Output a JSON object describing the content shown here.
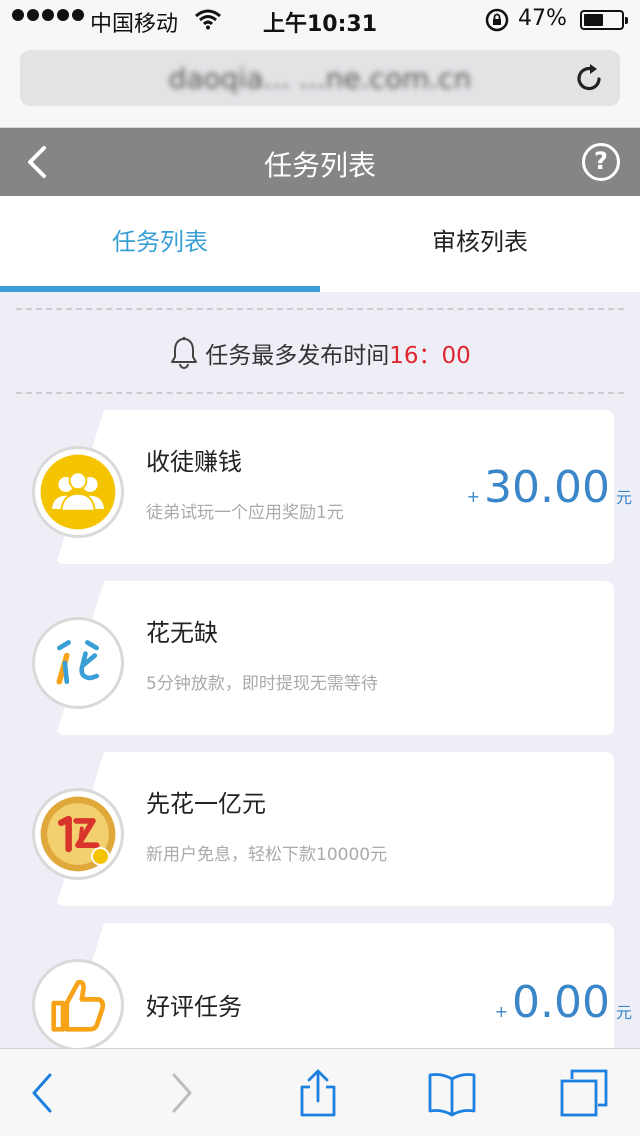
{
  "status_bar": {
    "carrier": "中国移动",
    "time": "上午10:31",
    "battery_percent": "47%",
    "battery_level": 0.47
  },
  "address_bar": {
    "url": "daoqia... ...ne.com.cn"
  },
  "nav": {
    "title": "任务列表",
    "help_symbol": "?"
  },
  "tabs": [
    {
      "label": "任务列表",
      "active": true
    },
    {
      "label": "审核列表",
      "active": false
    }
  ],
  "notice": {
    "text": "任务最多发布时间",
    "time": "16：00"
  },
  "tasks": [
    {
      "title": "收徒赚钱",
      "desc": "徒弟试玩一个应用奖励1元",
      "reward_plus": "+",
      "reward": "30.00",
      "reward_unit": "元",
      "icon": "team-icon"
    },
    {
      "title": "花无缺",
      "desc": "5分钟放款，即时提现无需等待",
      "icon": "hua-logo-icon"
    },
    {
      "title": "先花一亿元",
      "desc": "新用户免息，轻松下款10000元",
      "icon": "yi-logo-icon"
    },
    {
      "title": "好评任务",
      "desc": "",
      "reward_plus": "+",
      "reward": "0.00",
      "reward_unit": "元",
      "icon": "thumbs-up-icon"
    }
  ],
  "colors": {
    "accent": "#3a9fd6",
    "reward": "#3a86c8",
    "header": "#858585",
    "notice_time": "#e0252d"
  }
}
